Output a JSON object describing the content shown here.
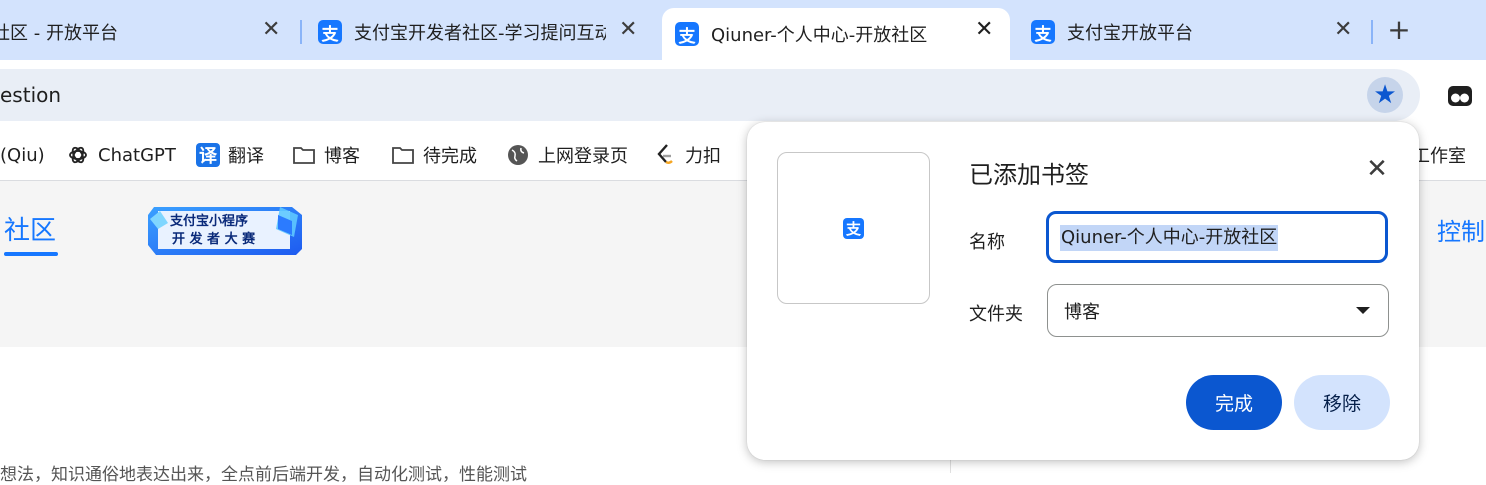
{
  "tabs": [
    {
      "label": "社区 - 开放平台",
      "favicon": "none"
    },
    {
      "label": "支付宝开发者社区-学习提问互动",
      "favicon": "alipay-icon"
    },
    {
      "label": "Qiuner-个人中心-开放社区",
      "favicon": "alipay-icon",
      "active": true
    },
    {
      "label": "支付宝开放平台",
      "favicon": "alipay-icon"
    }
  ],
  "favicon_glyph": "支",
  "omnibox": {
    "text": "estion"
  },
  "bookmarks": [
    {
      "label": "(Qiu)",
      "icon": "none"
    },
    {
      "label": "ChatGPT",
      "icon": "openai-icon"
    },
    {
      "label": "翻译",
      "icon": "translate-icon"
    },
    {
      "label": "博客",
      "icon": "folder-icon"
    },
    {
      "label": "待完成",
      "icon": "folder-icon"
    },
    {
      "label": "上网登录页",
      "icon": "globe-icon"
    },
    {
      "label": "力扣",
      "icon": "leetcode-icon"
    },
    {
      "label": "工作室",
      "icon": "none"
    }
  ],
  "translate_glyph": "译",
  "page": {
    "community_tab": "社区",
    "control_link": "控制",
    "banner_line1": "支付宝小程序",
    "banner_line2": "开 发 者 大 赛",
    "bottom_text": "想法，知识通俗地表达出来，全点前后端开发，自动化测试，性能测试"
  },
  "dialog": {
    "title": "已添加书签",
    "name_label": "名称",
    "name_value": "Qiuner-个人中心-开放社区",
    "folder_label": "文件夹",
    "folder_value": "博客",
    "done_label": "完成",
    "remove_label": "移除"
  },
  "colors": {
    "tabstrip_bg": "#d3e3fd",
    "accent": "#0b57d0",
    "alipay_blue": "#1677ff"
  }
}
